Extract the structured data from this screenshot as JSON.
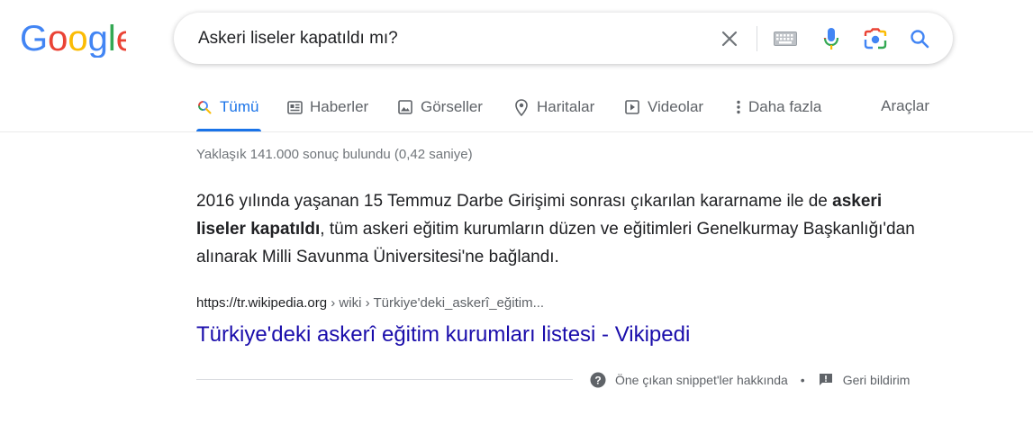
{
  "search": {
    "query": "Askeri liseler kapatıldı mı?",
    "logo_text": "Google"
  },
  "tabs": [
    {
      "label": "Tümü",
      "icon": "search-icon",
      "active": true
    },
    {
      "label": "Haberler",
      "icon": "news-icon"
    },
    {
      "label": "Görseller",
      "icon": "image-icon"
    },
    {
      "label": "Haritalar",
      "icon": "map-pin-icon"
    },
    {
      "label": "Videolar",
      "icon": "play-icon"
    },
    {
      "label": "Daha fazla",
      "icon": "more-vert-icon"
    }
  ],
  "tools_label": "Araçlar",
  "result_stats": "Yaklaşık 141.000 sonuç bulundu (0,42 saniye)",
  "snippet": {
    "part1": "2016 yılında yaşanan 15 Temmuz Darbe Girişimi sonrası çıkarılan kararname ile de ",
    "bold": "askeri liseler kapatıldı",
    "part2": ", tüm askeri eğitim kurumların düzen ve eğitimleri Genelkurmay Başkanlığı'dan alınarak Milli Savunma Üniversitesi'ne bağlandı."
  },
  "result": {
    "domain": "https://tr.wikipedia.org",
    "path": " › wiki › Türkiye'deki_askerî_eğitim...",
    "title": "Türkiye'deki askerî eğitim kurumları listesi - Vikipedi"
  },
  "footer": {
    "about_label": "Öne çıkan snippet'ler hakkında",
    "separator": "•",
    "feedback_label": "Geri bildirim"
  },
  "colors": {
    "accent": "#1a73e8",
    "link": "#1a0dab",
    "muted": "#70757a"
  }
}
